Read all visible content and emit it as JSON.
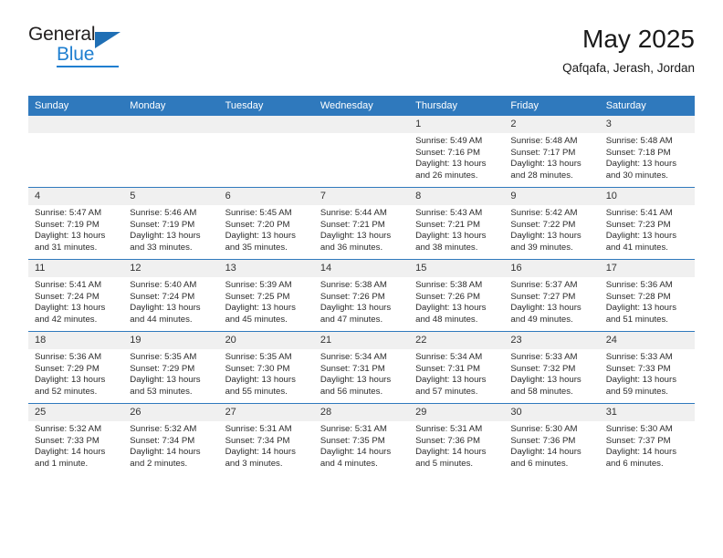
{
  "logo": {
    "word1": "General",
    "word2": "Blue",
    "triangle_color": "#1f6fb5",
    "blue_color": "#1f7fd0"
  },
  "header": {
    "title": "May 2025",
    "subtitle": "Qafqafa, Jerash, Jordan"
  },
  "theme": {
    "header_bg": "#2f79bd",
    "daynum_bg": "#f0f0f0",
    "row_divider": "#2f79bd"
  },
  "weekday_headers": [
    "Sunday",
    "Monday",
    "Tuesday",
    "Wednesday",
    "Thursday",
    "Friday",
    "Saturday"
  ],
  "weeks": [
    [
      {
        "day": "",
        "empty": true,
        "sunrise": "",
        "sunset": "",
        "daylight1": "",
        "daylight2": ""
      },
      {
        "day": "",
        "empty": true,
        "sunrise": "",
        "sunset": "",
        "daylight1": "",
        "daylight2": ""
      },
      {
        "day": "",
        "empty": true,
        "sunrise": "",
        "sunset": "",
        "daylight1": "",
        "daylight2": ""
      },
      {
        "day": "",
        "empty": true,
        "sunrise": "",
        "sunset": "",
        "daylight1": "",
        "daylight2": ""
      },
      {
        "day": "1",
        "sunrise": "Sunrise: 5:49 AM",
        "sunset": "Sunset: 7:16 PM",
        "daylight1": "Daylight: 13 hours",
        "daylight2": "and 26 minutes."
      },
      {
        "day": "2",
        "sunrise": "Sunrise: 5:48 AM",
        "sunset": "Sunset: 7:17 PM",
        "daylight1": "Daylight: 13 hours",
        "daylight2": "and 28 minutes."
      },
      {
        "day": "3",
        "sunrise": "Sunrise: 5:48 AM",
        "sunset": "Sunset: 7:18 PM",
        "daylight1": "Daylight: 13 hours",
        "daylight2": "and 30 minutes."
      }
    ],
    [
      {
        "day": "4",
        "sunrise": "Sunrise: 5:47 AM",
        "sunset": "Sunset: 7:19 PM",
        "daylight1": "Daylight: 13 hours",
        "daylight2": "and 31 minutes."
      },
      {
        "day": "5",
        "sunrise": "Sunrise: 5:46 AM",
        "sunset": "Sunset: 7:19 PM",
        "daylight1": "Daylight: 13 hours",
        "daylight2": "and 33 minutes."
      },
      {
        "day": "6",
        "sunrise": "Sunrise: 5:45 AM",
        "sunset": "Sunset: 7:20 PM",
        "daylight1": "Daylight: 13 hours",
        "daylight2": "and 35 minutes."
      },
      {
        "day": "7",
        "sunrise": "Sunrise: 5:44 AM",
        "sunset": "Sunset: 7:21 PM",
        "daylight1": "Daylight: 13 hours",
        "daylight2": "and 36 minutes."
      },
      {
        "day": "8",
        "sunrise": "Sunrise: 5:43 AM",
        "sunset": "Sunset: 7:21 PM",
        "daylight1": "Daylight: 13 hours",
        "daylight2": "and 38 minutes."
      },
      {
        "day": "9",
        "sunrise": "Sunrise: 5:42 AM",
        "sunset": "Sunset: 7:22 PM",
        "daylight1": "Daylight: 13 hours",
        "daylight2": "and 39 minutes."
      },
      {
        "day": "10",
        "sunrise": "Sunrise: 5:41 AM",
        "sunset": "Sunset: 7:23 PM",
        "daylight1": "Daylight: 13 hours",
        "daylight2": "and 41 minutes."
      }
    ],
    [
      {
        "day": "11",
        "sunrise": "Sunrise: 5:41 AM",
        "sunset": "Sunset: 7:24 PM",
        "daylight1": "Daylight: 13 hours",
        "daylight2": "and 42 minutes."
      },
      {
        "day": "12",
        "sunrise": "Sunrise: 5:40 AM",
        "sunset": "Sunset: 7:24 PM",
        "daylight1": "Daylight: 13 hours",
        "daylight2": "and 44 minutes."
      },
      {
        "day": "13",
        "sunrise": "Sunrise: 5:39 AM",
        "sunset": "Sunset: 7:25 PM",
        "daylight1": "Daylight: 13 hours",
        "daylight2": "and 45 minutes."
      },
      {
        "day": "14",
        "sunrise": "Sunrise: 5:38 AM",
        "sunset": "Sunset: 7:26 PM",
        "daylight1": "Daylight: 13 hours",
        "daylight2": "and 47 minutes."
      },
      {
        "day": "15",
        "sunrise": "Sunrise: 5:38 AM",
        "sunset": "Sunset: 7:26 PM",
        "daylight1": "Daylight: 13 hours",
        "daylight2": "and 48 minutes."
      },
      {
        "day": "16",
        "sunrise": "Sunrise: 5:37 AM",
        "sunset": "Sunset: 7:27 PM",
        "daylight1": "Daylight: 13 hours",
        "daylight2": "and 49 minutes."
      },
      {
        "day": "17",
        "sunrise": "Sunrise: 5:36 AM",
        "sunset": "Sunset: 7:28 PM",
        "daylight1": "Daylight: 13 hours",
        "daylight2": "and 51 minutes."
      }
    ],
    [
      {
        "day": "18",
        "sunrise": "Sunrise: 5:36 AM",
        "sunset": "Sunset: 7:29 PM",
        "daylight1": "Daylight: 13 hours",
        "daylight2": "and 52 minutes."
      },
      {
        "day": "19",
        "sunrise": "Sunrise: 5:35 AM",
        "sunset": "Sunset: 7:29 PM",
        "daylight1": "Daylight: 13 hours",
        "daylight2": "and 53 minutes."
      },
      {
        "day": "20",
        "sunrise": "Sunrise: 5:35 AM",
        "sunset": "Sunset: 7:30 PM",
        "daylight1": "Daylight: 13 hours",
        "daylight2": "and 55 minutes."
      },
      {
        "day": "21",
        "sunrise": "Sunrise: 5:34 AM",
        "sunset": "Sunset: 7:31 PM",
        "daylight1": "Daylight: 13 hours",
        "daylight2": "and 56 minutes."
      },
      {
        "day": "22",
        "sunrise": "Sunrise: 5:34 AM",
        "sunset": "Sunset: 7:31 PM",
        "daylight1": "Daylight: 13 hours",
        "daylight2": "and 57 minutes."
      },
      {
        "day": "23",
        "sunrise": "Sunrise: 5:33 AM",
        "sunset": "Sunset: 7:32 PM",
        "daylight1": "Daylight: 13 hours",
        "daylight2": "and 58 minutes."
      },
      {
        "day": "24",
        "sunrise": "Sunrise: 5:33 AM",
        "sunset": "Sunset: 7:33 PM",
        "daylight1": "Daylight: 13 hours",
        "daylight2": "and 59 minutes."
      }
    ],
    [
      {
        "day": "25",
        "sunrise": "Sunrise: 5:32 AM",
        "sunset": "Sunset: 7:33 PM",
        "daylight1": "Daylight: 14 hours",
        "daylight2": "and 1 minute."
      },
      {
        "day": "26",
        "sunrise": "Sunrise: 5:32 AM",
        "sunset": "Sunset: 7:34 PM",
        "daylight1": "Daylight: 14 hours",
        "daylight2": "and 2 minutes."
      },
      {
        "day": "27",
        "sunrise": "Sunrise: 5:31 AM",
        "sunset": "Sunset: 7:34 PM",
        "daylight1": "Daylight: 14 hours",
        "daylight2": "and 3 minutes."
      },
      {
        "day": "28",
        "sunrise": "Sunrise: 5:31 AM",
        "sunset": "Sunset: 7:35 PM",
        "daylight1": "Daylight: 14 hours",
        "daylight2": "and 4 minutes."
      },
      {
        "day": "29",
        "sunrise": "Sunrise: 5:31 AM",
        "sunset": "Sunset: 7:36 PM",
        "daylight1": "Daylight: 14 hours",
        "daylight2": "and 5 minutes."
      },
      {
        "day": "30",
        "sunrise": "Sunrise: 5:30 AM",
        "sunset": "Sunset: 7:36 PM",
        "daylight1": "Daylight: 14 hours",
        "daylight2": "and 6 minutes."
      },
      {
        "day": "31",
        "sunrise": "Sunrise: 5:30 AM",
        "sunset": "Sunset: 7:37 PM",
        "daylight1": "Daylight: 14 hours",
        "daylight2": "and 6 minutes."
      }
    ]
  ]
}
